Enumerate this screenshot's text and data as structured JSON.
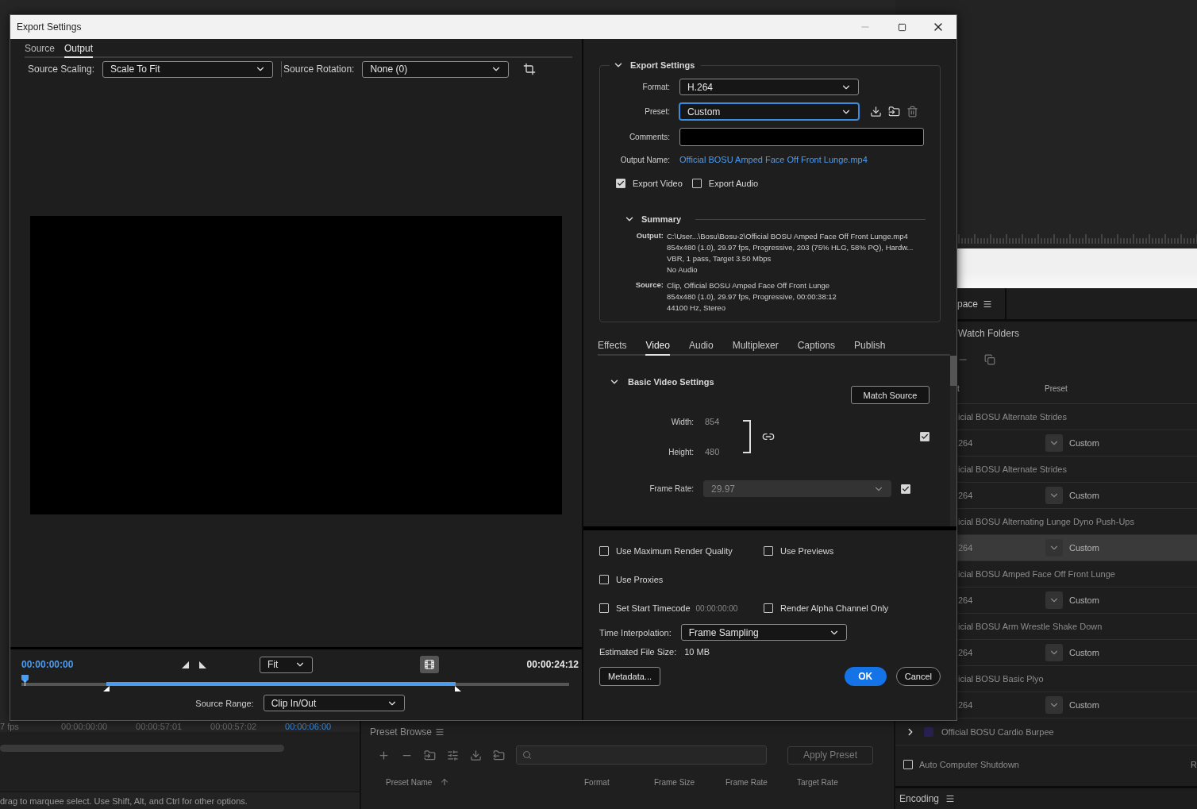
{
  "window": {
    "title": "Export Settings"
  },
  "source_tabs": [
    {
      "label": "Source",
      "selected": false
    },
    {
      "label": "Output",
      "selected": true
    }
  ],
  "source_scaling": {
    "label": "Source Scaling:",
    "value": "Scale To Fit"
  },
  "source_rotation": {
    "label": "Source Rotation:",
    "value": "None (0)"
  },
  "playback": {
    "current_time": "00:00:00:00",
    "zoom": "Fit",
    "duration": "00:00:24:12"
  },
  "source_range": {
    "label": "Source Range:",
    "value": "Clip In/Out"
  },
  "export_settings": {
    "title": "Export Settings",
    "expanded": true,
    "format": {
      "label": "Format:",
      "value": "H.264"
    },
    "preset": {
      "label": "Preset:",
      "value": "Custom",
      "focused": true
    },
    "comments": {
      "label": "Comments:"
    },
    "output_name": {
      "label": "Output Name:",
      "value": "Official BOSU Amped Face Off Front Lunge.mp4"
    },
    "toggles": [
      {
        "label": "Export Video",
        "checked": true
      },
      {
        "label": "Export Audio",
        "checked": false
      }
    ]
  },
  "summary": {
    "title": "Summary",
    "expanded": true,
    "sections": [
      {
        "label": "Output:",
        "lines": [
          "C:\\User...\\Bosu\\Bosu-2\\Official BOSU Amped Face Off Front Lunge.mp4",
          "854x480 (1.0), 29.97 fps, Progressive, 203 (75% HLG, 58% PQ), Hardw...",
          "VBR, 1 pass, Target 3.50 Mbps",
          "No Audio"
        ]
      },
      {
        "label": "Source:",
        "lines": [
          "Clip, Official BOSU Amped Face Off Front Lunge",
          "854x480 (1.0), 29.97 fps, Progressive, 00:00:38:12",
          "44100 Hz, Stereo"
        ]
      }
    ]
  },
  "settings_tabs": [
    {
      "label": "Effects",
      "selected": false
    },
    {
      "label": "Video",
      "selected": true
    },
    {
      "label": "Audio",
      "selected": false
    },
    {
      "label": "Multiplexer",
      "selected": false
    },
    {
      "label": "Captions",
      "selected": false
    },
    {
      "label": "Publish",
      "selected": false
    }
  ],
  "basic_video": {
    "title": "Basic Video Settings",
    "expanded": true,
    "match_button": "Match Source",
    "width": {
      "label": "Width:",
      "value": "854"
    },
    "height": {
      "label": "Height:",
      "value": "480"
    },
    "size_checked": true,
    "frame_rate": {
      "label": "Frame Rate:",
      "value": "29.97",
      "disabled": true,
      "checked": true
    }
  },
  "option_rows": [
    [
      {
        "label": "Use Maximum Render Quality",
        "checked": false
      },
      {
        "label": "Use Previews",
        "checked": false
      }
    ],
    [
      {
        "label": "Use Proxies",
        "checked": false
      }
    ],
    [
      {
        "label": "Set Start Timecode",
        "checked": false,
        "value": "00:00:00:00"
      },
      {
        "label": "Render Alpha Channel Only",
        "checked": false
      }
    ]
  ],
  "time_interpolation": {
    "label": "Time Interpolation:",
    "value": "Frame Sampling"
  },
  "file_size": {
    "label": "Estimated File Size:",
    "value": "10 MB"
  },
  "buttons": {
    "metadata": "Metadata...",
    "ok": "OK",
    "cancel": "Cancel"
  },
  "timeline": {
    "fps": "7 fps",
    "ruler": [
      {
        "label": "00:00:00:00",
        "selected": false
      },
      {
        "label": "00:00:57:01",
        "selected": false
      },
      {
        "label": "00:00:57:02",
        "selected": false
      },
      {
        "label": "00:00:06:00",
        "selected": true
      }
    ]
  },
  "status_bar": "drag to marquee select. Use Shift, Alt, and Ctrl for other options.",
  "preset_browser": {
    "title": "Preset Browse",
    "apply_button": "Apply Preset",
    "columns": [
      "Preset Name",
      "Format",
      "Frame Size",
      "Frame Rate",
      "Target Rate"
    ]
  },
  "workspace_tab": "pace",
  "queue": {
    "tab": "Watch Folders",
    "columns": [
      "t",
      "Preset"
    ],
    "items": [
      {
        "name": "icial BOSU Alternate Strides",
        "format": "264",
        "preset": "Custom",
        "selected": false
      },
      {
        "name": "icial BOSU Alternate Strides",
        "format": "264",
        "preset": "Custom",
        "selected": false
      },
      {
        "name": "icial BOSU Alternating Lunge Dyno Push-Ups",
        "format": "264",
        "preset": "Custom",
        "selected": true
      },
      {
        "name": "icial BOSU Amped Face Off Front Lunge",
        "format": "264",
        "preset": "Custom",
        "selected": false
      },
      {
        "name": "icial BOSU Arm Wrestle Shake Down",
        "format": "264",
        "preset": "Custom",
        "selected": false
      },
      {
        "name": "icial BOSU Basic Plyo",
        "format": "264",
        "preset": "Custom",
        "selected": false
      }
    ],
    "last_item": {
      "name": "Official BOSU Cardio Burpee",
      "expanded": false
    },
    "auto_shutdown": {
      "label": "Auto Computer Shutdown",
      "checked": false
    },
    "right_label": "R"
  },
  "encoding_tab": "Encoding"
}
